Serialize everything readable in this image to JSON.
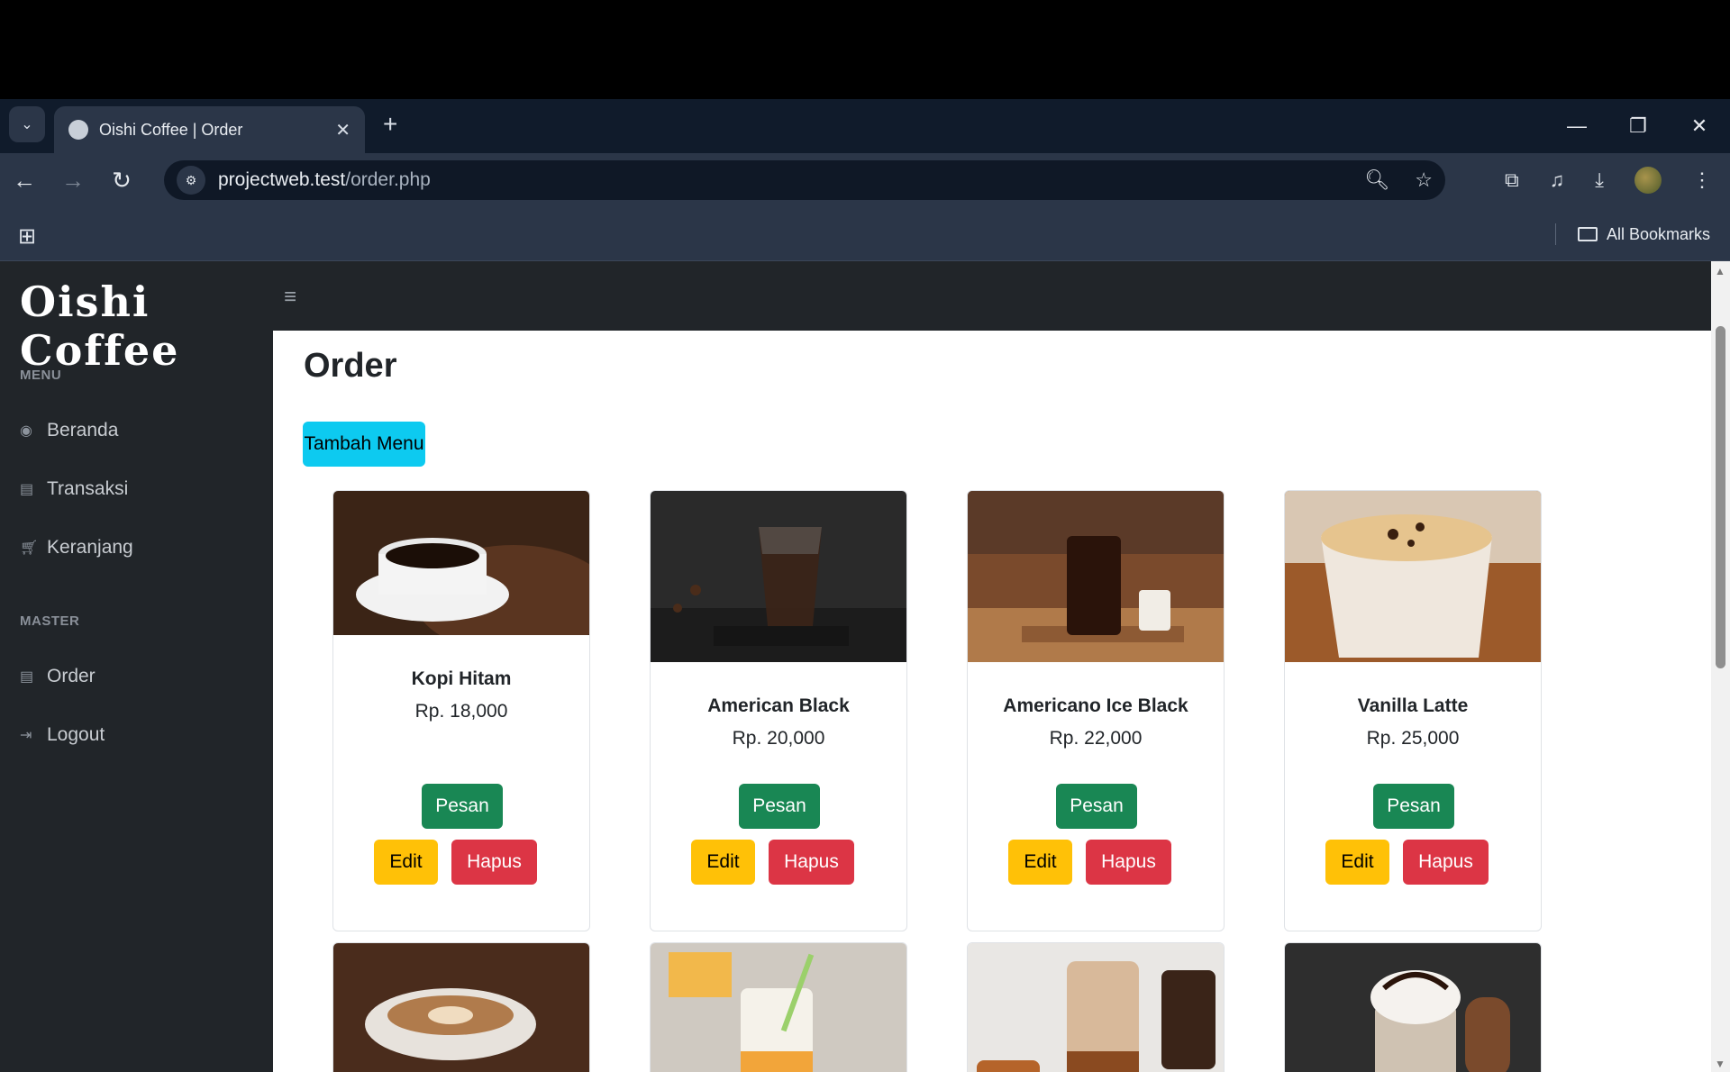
{
  "browser": {
    "tab_title": "Oishi Coffee | Order",
    "url_host": "projectweb.test",
    "url_path": "/order.php",
    "bookmarks_label": "All Bookmarks"
  },
  "sidebar": {
    "brand": "Oishi Coffee",
    "menu_heading": "MENU",
    "master_heading": "MASTER",
    "items": [
      {
        "label": "Beranda",
        "icon": "palette-icon"
      },
      {
        "label": "Transaksi",
        "icon": "card-icon"
      },
      {
        "label": "Keranjang",
        "icon": "cart-icon"
      },
      {
        "label": "Order",
        "icon": "card-icon"
      },
      {
        "label": "Logout",
        "icon": "logout-icon"
      }
    ]
  },
  "main": {
    "title": "Order",
    "add_button": "Tambah Menu",
    "order_label": "Pesan",
    "edit_label": "Edit",
    "delete_label": "Hapus",
    "products": [
      {
        "name": "Kopi Hitam",
        "price": "Rp. 18,000"
      },
      {
        "name": "American Black",
        "price": "Rp. 20,000"
      },
      {
        "name": "Americano Ice Black",
        "price": "Rp. 22,000"
      },
      {
        "name": "Vanilla Latte",
        "price": "Rp. 25,000"
      }
    ]
  },
  "colors": {
    "sidebar_bg": "#212529",
    "add_button": "#0dcaf0",
    "order_button": "#198754",
    "edit_button": "#ffc107",
    "delete_button": "#dc3545"
  }
}
